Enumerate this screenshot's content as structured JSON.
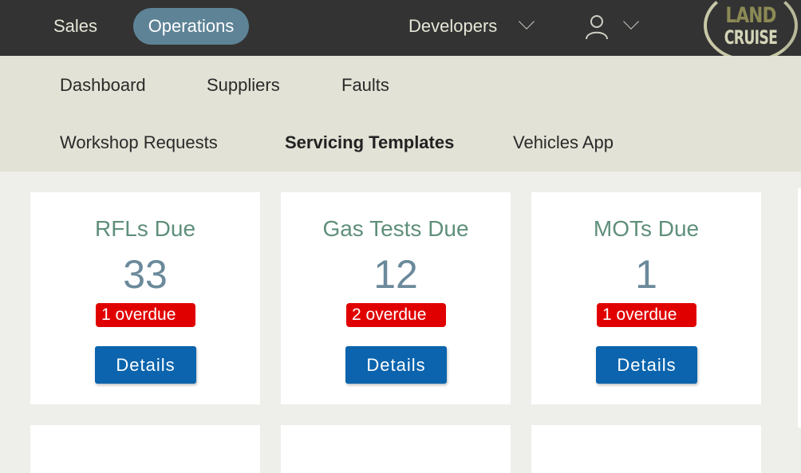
{
  "topbar": {
    "items": [
      {
        "label": "Sales",
        "active": false
      },
      {
        "label": "Operations",
        "active": true
      }
    ],
    "developers_label": "Developers",
    "user_menu": "user-icon",
    "logo": {
      "line1": "LAND",
      "line2": "CRUISE"
    }
  },
  "subnav": {
    "items": [
      {
        "label": "Dashboard"
      },
      {
        "label": "Suppliers"
      },
      {
        "label": "Faults"
      },
      {
        "label": "Workshop Requests"
      },
      {
        "label": "Servicing Templates",
        "active": true
      },
      {
        "label": "Vehicles App"
      }
    ]
  },
  "cards": [
    {
      "title": "RFLs Due",
      "count": "33",
      "overdue": "1 overdue",
      "button": "Details"
    },
    {
      "title": "Gas Tests Due",
      "count": "12",
      "overdue": "2 overdue",
      "button": "Details"
    },
    {
      "title": "MOTs Due",
      "count": "1",
      "overdue": "1 overdue",
      "button": "Details"
    }
  ],
  "colors": {
    "topbar_bg": "#333333",
    "active_pill": "#5e8396",
    "subnav_bg": "#e2e2d6",
    "card_title": "#5f8f7a",
    "card_count": "#6b8a9b",
    "overdue_badge": "#e00000",
    "details_button": "#0b64ad"
  }
}
